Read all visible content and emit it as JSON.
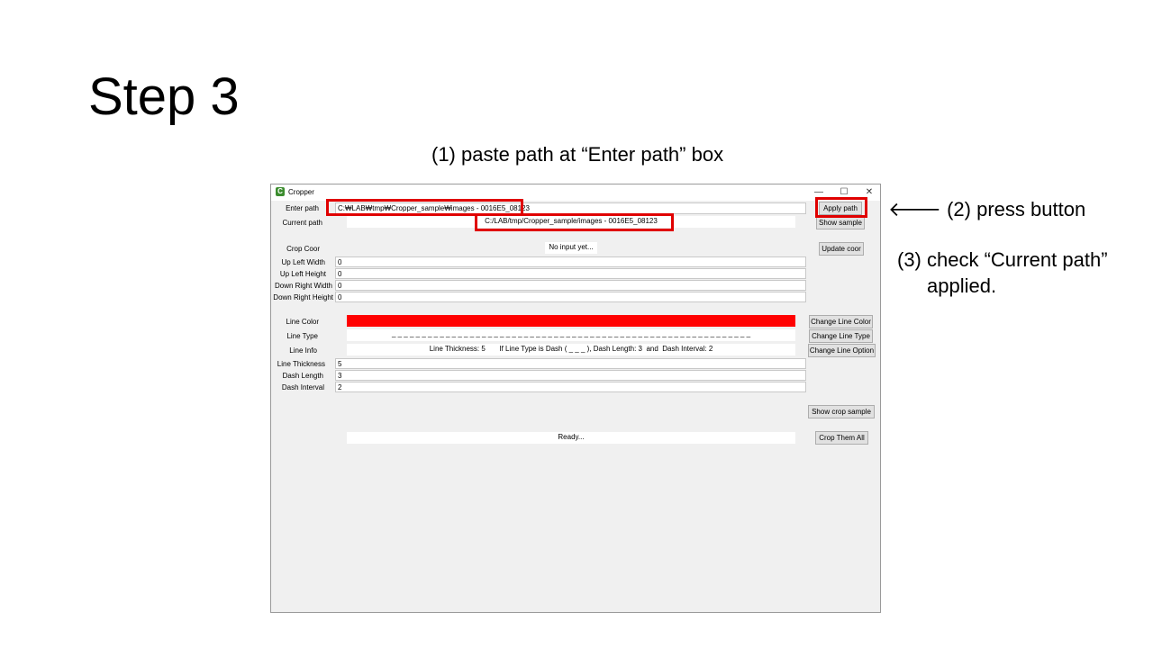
{
  "slide": {
    "title": "Step 3",
    "note1": "(1) paste path at “Enter path” box",
    "note2": "🡐 (2) press button",
    "note3_line1": "(3) check “Current path”",
    "note3_line2": "applied."
  },
  "window": {
    "title": "Cropper",
    "app_icon_letter": "C",
    "minimize": "—",
    "maximize": "☐",
    "close": "✕"
  },
  "labels": {
    "enter_path": "Enter path",
    "current_path": "Current path",
    "crop_coor": "Crop Coor",
    "up_left_width": "Up Left Width",
    "up_left_height": "Up Left Height",
    "down_right_width": "Down Right Width",
    "down_right_height": "Down Right Height",
    "line_color": "Line Color",
    "line_type": "Line Type",
    "line_info": "Line Info",
    "line_thickness": "Line Thickness",
    "dash_length": "Dash Length",
    "dash_interval": "Dash Interval"
  },
  "values": {
    "enter_path": "C:₩LAB₩tmp₩Cropper_sample₩images - 0016E5_08123",
    "current_path": "C:/LAB/tmp/Cropper_sample/images - 0016E5_08123",
    "crop_coor": "No input yet...",
    "up_left_width": "0",
    "up_left_height": "0",
    "down_right_width": "0",
    "down_right_height": "0",
    "line_type": "_ _ _ _ _ _ _ _ _ _ _ _ _ _ _ _ _ _ _ _ _ _ _ _ _ _ _ _ _ _ _ _ _ _ _ _ _ _ _ _ _ _ _ _ _ _ _ _ _ _ _ _ _ _ _ _ _ _ _ _",
    "line_info": "Line Thickness: 5       If Line Type is Dash ( _ _ _ ), Dash Length: 3  and  Dash Interval: 2",
    "line_thickness": "5",
    "dash_length": "3",
    "dash_interval": "2",
    "status": "Ready..."
  },
  "buttons": {
    "apply_path": "Apply path",
    "show_sample": "Show sample",
    "update_coor": "Update coor",
    "change_line_color": "Change Line Color",
    "change_line_type": "Change Line Type",
    "change_line_option": "Change Line Option",
    "show_crop_sample": "Show crop sample",
    "crop_them_all": "Crop Them All"
  },
  "colors": {
    "line_color": "#ff0000",
    "highlight": "#e00000"
  }
}
